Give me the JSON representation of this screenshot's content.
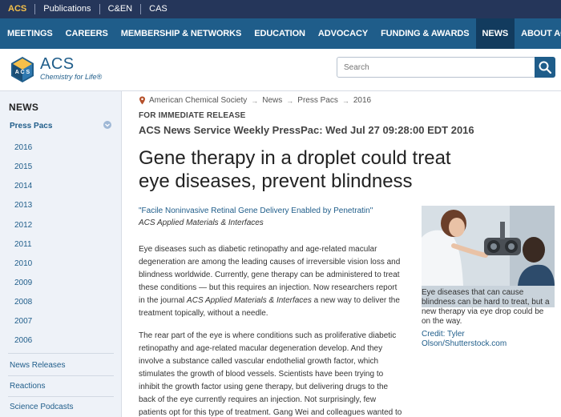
{
  "topbar": {
    "items": [
      "ACS",
      "Publications",
      "C&EN",
      "CAS"
    ]
  },
  "nav": {
    "items": [
      "MEETINGS",
      "CAREERS",
      "MEMBERSHIP & NETWORKS",
      "EDUCATION",
      "ADVOCACY",
      "FUNDING & AWARDS",
      "NEWS",
      "ABOUT ACS"
    ],
    "active": "NEWS"
  },
  "logo": {
    "name": "ACS",
    "tagline": "Chemistry for Life®"
  },
  "search": {
    "placeholder": "Search"
  },
  "sidebar": {
    "title": "NEWS",
    "section": "Press Pacs",
    "years": [
      "2016",
      "2015",
      "2014",
      "2013",
      "2012",
      "2011",
      "2010",
      "2009",
      "2008",
      "2007",
      "2006"
    ],
    "links": [
      "News Releases",
      "Reactions",
      "Science Podcasts"
    ]
  },
  "breadcrumb": [
    "American Chemical Society",
    "News",
    "Press Pacs",
    "2016"
  ],
  "article": {
    "release_label": "FOR IMMEDIATE RELEASE",
    "presspac_heading": "ACS News Service Weekly PressPac: Wed Jul 27 09:28:00 EDT 2016",
    "headline": "Gene therapy in a droplet could treat eye diseases, prevent blindness",
    "citation_title": "\"Facile Noninvasive Retinal Gene Delivery Enabled by Penetratin\"",
    "citation_journal": "ACS Applied Materials & Interfaces",
    "para1_a": "Eye diseases such as diabetic retinopathy and age-related macular degeneration are among the leading causes of irreversible vision loss and blindness worldwide. Currently, gene therapy can be administered to treat these conditions — but this requires an injection. Now researchers report in the journal ",
    "para1_journal": "ACS Applied Materials & Interfaces",
    "para1_b": " a new way to deliver the treatment topically, without a needle.",
    "para2": "The rear part of the eye is where conditions such as proliferative diabetic retinopathy and age-related macular degeneration develop. And they involve a substance called vascular endothelial growth factor, which stimulates the growth of blood vessels. Scientists have been trying to inhibit the growth factor using gene therapy, but delivering drugs to the back of the eye currently requires an injection. Not surprisingly, few patients opt for this type of treatment. Gang Wei and colleagues wanted to find a noninvasive approach.",
    "figure_caption": "Eye diseases that can cause blindness can be hard to treat, but a new therapy via eye drop could be on the way.",
    "figure_credit": "Credit: Tyler Olson/Shutterstock.com"
  },
  "colors": {
    "topbar": "#25365a",
    "nav": "#1f5d8a",
    "nav_active": "#123b5e",
    "accent": "#f5c04a",
    "link": "#1f5d8a",
    "sidebar_bg": "#eef2f8"
  }
}
